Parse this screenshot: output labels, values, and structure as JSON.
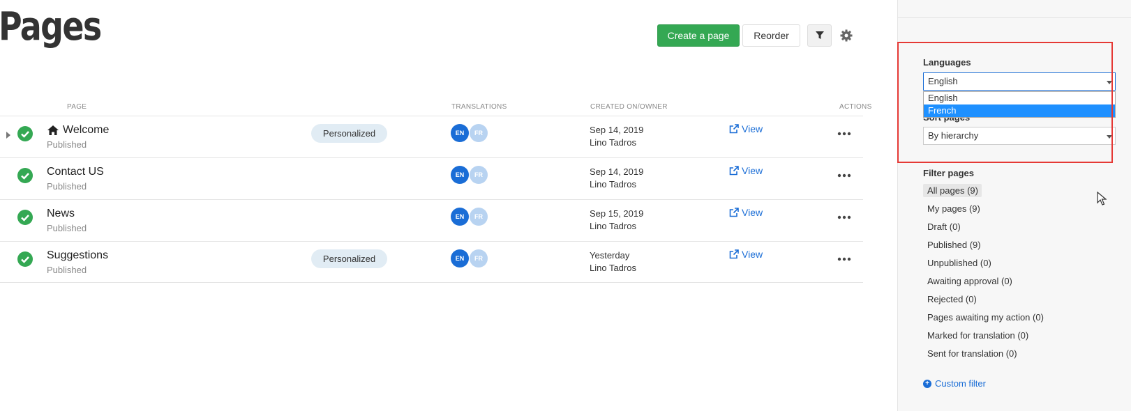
{
  "page_title": "Pages",
  "toolbar": {
    "create_label": "Create a page",
    "reorder_label": "Reorder",
    "filter_icon": "filter-icon",
    "settings_icon": "gear-icon"
  },
  "columns": {
    "page": "PAGE",
    "translations": "TRANSLATIONS",
    "created": "CREATED ON/OWNER",
    "actions": "ACTIONS"
  },
  "rows": [
    {
      "title": "Welcome",
      "status": "Published",
      "badge": "Personalized",
      "lang_en": "EN",
      "lang_fr": "FR",
      "date": "Sep 14, 2019",
      "owner": "Lino Tadros",
      "view": "View",
      "home": true,
      "expandable": true
    },
    {
      "title": "Contact US",
      "status": "Published",
      "badge": "",
      "lang_en": "EN",
      "lang_fr": "FR",
      "date": "Sep 14, 2019",
      "owner": "Lino Tadros",
      "view": "View"
    },
    {
      "title": "News",
      "status": "Published",
      "badge": "",
      "lang_en": "EN",
      "lang_fr": "FR",
      "date": "Sep 15, 2019",
      "owner": "Lino Tadros",
      "view": "View"
    },
    {
      "title": "Suggestions",
      "status": "Published",
      "badge": "Personalized",
      "lang_en": "EN",
      "lang_fr": "FR",
      "date": "Yesterday",
      "owner": "Lino Tadros",
      "view": "View"
    }
  ],
  "sidebar": {
    "languages_label": "Languages",
    "languages_value": "English",
    "languages_options": [
      "English",
      "French"
    ],
    "sort_label": "Sort pages",
    "sort_value": "By hierarchy",
    "filter_label": "Filter pages",
    "filters": [
      "All pages (9)",
      "My pages (9)",
      "Draft (0)",
      "Published (9)",
      "Unpublished (0)",
      "Awaiting approval (0)",
      "Rejected (0)",
      "Pages awaiting my action (0)",
      "Marked for translation (0)",
      "Sent for translation (0)"
    ],
    "custom_filter": "Custom filter"
  },
  "colors": {
    "accent": "#1a6dd6",
    "success": "#34a853",
    "highlight": "#e53935"
  }
}
